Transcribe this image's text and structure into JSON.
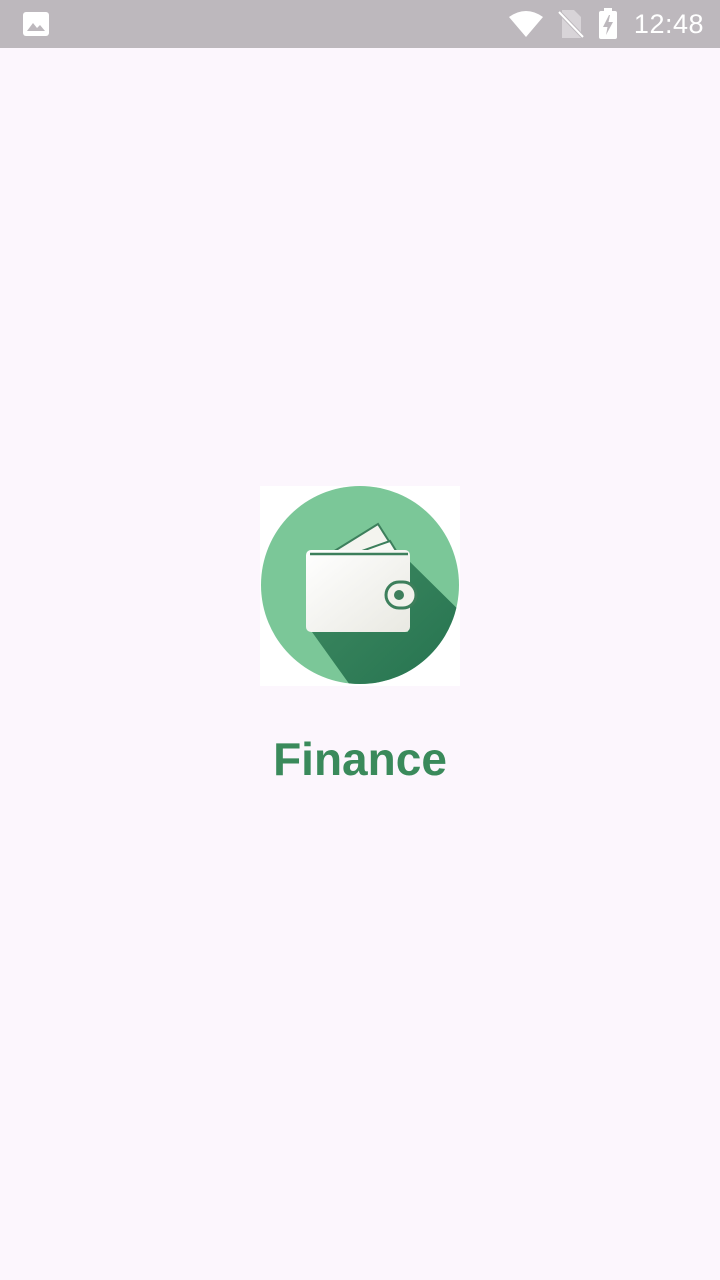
{
  "status_bar": {
    "time": "12:48",
    "icons": [
      "image-notification-icon",
      "wifi-icon",
      "no-sim-icon",
      "battery-charging-icon"
    ]
  },
  "splash": {
    "app_name": "Finance",
    "logo_icon": "wallet-icon"
  },
  "colors": {
    "background": "#fcf6fd",
    "status_bar": "#bdb8bd",
    "title": "#3a8a5b",
    "logo_circle": "#7bc798",
    "logo_shadow": "#2a7654"
  }
}
